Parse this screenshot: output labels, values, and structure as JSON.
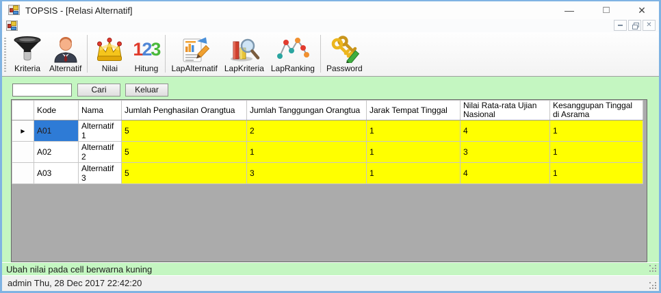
{
  "window": {
    "title": "TOPSIS - [Relasi Alternatif]",
    "controls": {
      "minimize": "—",
      "maximize": "□",
      "close": "✕"
    },
    "mdi_controls": {
      "close": "✕"
    }
  },
  "toolbar": {
    "buttons": [
      {
        "label": "Kriteria",
        "icon": "funnel-icon"
      },
      {
        "label": "Alternatif",
        "icon": "person-icon"
      },
      {
        "label": "Nilai",
        "icon": "crown-icon"
      },
      {
        "label": "Hitung",
        "icon": "numbers-123-icon"
      },
      {
        "label": "LapAlternatif",
        "icon": "report-document-icon"
      },
      {
        "label": "LapKriteria",
        "icon": "barchart-magnifier-icon"
      },
      {
        "label": "LapRanking",
        "icon": "line-chart-icon"
      },
      {
        "label": "Password",
        "icon": "keys-pencil-icon"
      }
    ],
    "hitung_digits": {
      "d1": "1",
      "d2": "2",
      "d3": "3"
    }
  },
  "search": {
    "input_value": "",
    "cari_label": "Cari",
    "keluar_label": "Keluar"
  },
  "grid": {
    "row_selector_glyph": "▶",
    "columns": [
      "Kode",
      "Nama",
      "Jumlah Penghasilan Orangtua",
      "Jumlah Tanggungan Orangtua",
      "Jarak Tempat Tinggal",
      "Nilai Rata-rata Ujian Nasional",
      "Kesanggupan Tinggal di Asrama"
    ],
    "rows": [
      {
        "kode": "A01",
        "nama": "Alternatif 1",
        "values": [
          "5",
          "2",
          "1",
          "4",
          "1"
        ]
      },
      {
        "kode": "A02",
        "nama": "Alternatif 2",
        "values": [
          "5",
          "1",
          "1",
          "3",
          "1"
        ]
      },
      {
        "kode": "A03",
        "nama": "Alternatif 3",
        "values": [
          "5",
          "3",
          "1",
          "4",
          "1"
        ]
      }
    ]
  },
  "status": {
    "message": "Ubah nilai pada cell berwarna kuning",
    "footer": "admin Thu, 28 Dec 2017 22:42:20"
  },
  "colors": {
    "window_border": "#7fb3e3",
    "client_background": "#c4f6c1",
    "editable_cell": "#ffff00",
    "selected_cell": "#2e7bd6",
    "grid_background": "#ababab"
  }
}
